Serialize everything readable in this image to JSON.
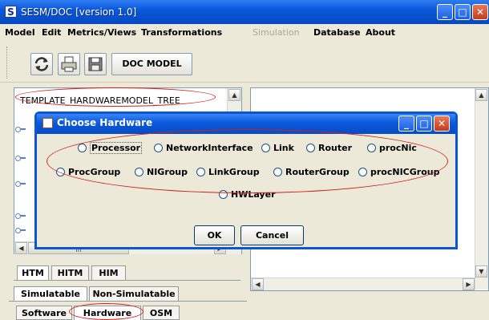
{
  "window": {
    "title": "SESM/DOC [version 1.0]",
    "app_icon_letter": "S",
    "minimize": "_",
    "maximize": "□",
    "close": "✕"
  },
  "menu": {
    "items": [
      {
        "label": "Model",
        "enabled": true
      },
      {
        "label": "Edit",
        "enabled": true
      },
      {
        "label": "Metrics/Views",
        "enabled": true
      },
      {
        "label": "Transformations",
        "enabled": true
      },
      {
        "label": "Simulation",
        "enabled": false
      },
      {
        "label": "Database",
        "enabled": true
      },
      {
        "label": "About",
        "enabled": true
      }
    ]
  },
  "toolbar": {
    "icons": [
      "refresh-icon",
      "print-icon",
      "save-icon"
    ],
    "doc_model_label": "DOC MODEL"
  },
  "tree": {
    "root_label": "TEMPLATE_HARDWAREMODEL_TREE"
  },
  "model_tabs": [
    "HTM",
    "HITM",
    "HIM"
  ],
  "sim_tabs": [
    "Simulatable",
    "Non-Simulatable"
  ],
  "bottom_tabs": [
    "Software",
    "Hardware",
    "OSM"
  ],
  "dialog": {
    "title": "Choose Hardware",
    "row1": [
      "Processor",
      "NetworkInterface",
      "Link",
      "Router",
      "procNic"
    ],
    "row2": [
      "ProcGroup",
      "NIGroup",
      "LinkGroup",
      "RouterGroup",
      "procNICGroup"
    ],
    "row3": [
      "HWLayer"
    ],
    "ok_label": "OK",
    "cancel_label": "Cancel"
  },
  "colors": {
    "title_bar": "#0a58dc",
    "annotation_ellipse": "#d21f1f",
    "window_background": "#ece9d8"
  }
}
